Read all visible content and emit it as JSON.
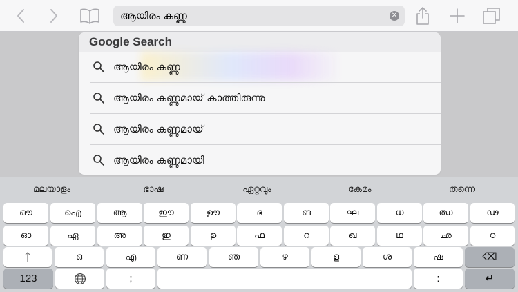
{
  "browser": {
    "url_text": "ആയിരം കണ്ണു"
  },
  "suggestions": {
    "header": "Google Search",
    "items": [
      "ആയിരം കണ്ണു",
      "ആയിരം കണ്ണുമായ് കാത്തിരുന്നു",
      "ആയിരം കണ്ണുമായ്",
      "ആയിരം കണ്ണുമായി"
    ]
  },
  "keyboard": {
    "predictions": [
      "മലയാളം",
      "ഭാഷ",
      "ഏറ്റവും",
      "കേമം",
      "തന്നെ"
    ],
    "row1": [
      "ഔ",
      "ഐ",
      "ആ",
      "ഈ",
      "ഊ",
      "ഭ",
      "ങ",
      "ഘ",
      "ധ",
      "ഝ",
      "ഢ"
    ],
    "row2": [
      "ഓ",
      "ഏ",
      "അ",
      "ഇ",
      "ഉ",
      "ഫ",
      "റ",
      "ഖ",
      "ഥ",
      "ഛ",
      "ഠ"
    ],
    "row3": [
      "ഒ",
      "എ",
      "ണ",
      "ഞ",
      "ഴ",
      "ള",
      "ശ",
      "ഷ"
    ],
    "numbers_label": "123",
    "semicolon_label": ";",
    "colon_label": ":",
    "delete_glyph": "⌫",
    "return_glyph": "↵",
    "shift_glyph": "⇧"
  },
  "colors": {
    "accent_icon": "#a9a9ae",
    "toolbar_bg": "#f7f7f8",
    "keyboard_bg": "#d2d4d7"
  },
  "icons": [
    "back-icon",
    "forward-icon",
    "bookmarks-icon",
    "clear-icon",
    "share-icon",
    "new-tab-icon",
    "tabs-icon",
    "search-icon",
    "globe-icon"
  ]
}
